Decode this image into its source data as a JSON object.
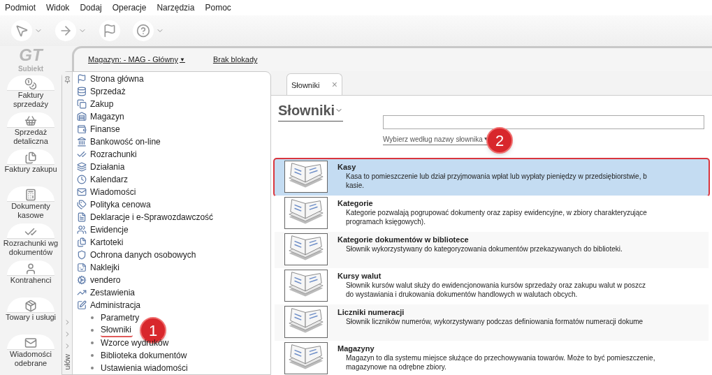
{
  "menu": [
    "Podmiot",
    "Widok",
    "Dodaj",
    "Operacje",
    "Narzędzia",
    "Pomoc"
  ],
  "toolbar": [
    {
      "dropdown": true
    },
    {
      "dropdown": true
    },
    {
      "dropdown": false
    },
    {
      "dropdown": true
    }
  ],
  "logo": {
    "mark": "GT",
    "name": "Subiekt"
  },
  "rail": [
    "Faktury sprzedaży",
    "Sprzedaż detaliczna",
    "Faktury zakupu",
    "Dokumenty kasowe",
    "Rozrachunki wg dokumentów",
    "Kontrahenci",
    "Towary i usługi",
    "Wiadomości odebrane"
  ],
  "header": {
    "warehouse": "Magazyn: - MAG - Główny",
    "warehouse_caret": "▼",
    "lock": "Brak blokady"
  },
  "side_strip": {
    "label": "ułów"
  },
  "nav": [
    {
      "label": "Strona główna"
    },
    {
      "label": "Sprzedaż"
    },
    {
      "label": "Zakup"
    },
    {
      "label": "Magazyn"
    },
    {
      "label": "Finanse"
    },
    {
      "label": "Bankowość on-line"
    },
    {
      "label": "Rozrachunki"
    },
    {
      "label": "Działania"
    },
    {
      "label": "Kalendarz"
    },
    {
      "label": "Wiadomości"
    },
    {
      "label": "Polityka cenowa"
    },
    {
      "label": "Deklaracje i e-Sprawozdawczość"
    },
    {
      "label": "Ewidencje"
    },
    {
      "label": "Kartoteki"
    },
    {
      "label": "Ochrona danych osobowych"
    },
    {
      "label": "Naklejki"
    },
    {
      "label": "vendero"
    },
    {
      "label": "Zestawienia"
    },
    {
      "label": "Administracja",
      "children": [
        {
          "label": "Parametry"
        },
        {
          "label": "Słowniki",
          "callout": "1"
        },
        {
          "label": "Wzorce wydruków"
        },
        {
          "label": "Biblioteka dokumentów"
        },
        {
          "label": "Ustawienia wiadomości"
        }
      ]
    }
  ],
  "tab": {
    "label": "Słowniki",
    "close": "×"
  },
  "title": "Słowniki",
  "search": {
    "filter_link": "Wybierz według nazwy słownika",
    "filter_caret": "▼",
    "callout": "2"
  },
  "dictionaries": [
    {
      "name": "Kasy",
      "selected": true,
      "outlined": true,
      "lines": [
        "Kasa to pomieszczenie lub dział przyjmowania wpłat lub wypłaty pieniędzy w przedsiębiorstwie, b",
        "kasie."
      ]
    },
    {
      "name": "Kategorie",
      "selected": false,
      "outlined": false,
      "lines": [
        "Kategorie pozwalają pogrupować dokumenty oraz zapisy ewidencyjne, w zbiory charakteryzujące",
        "programach księgowych)."
      ]
    },
    {
      "name": "Kategorie dokumentów w bibliotece",
      "selected": false,
      "outlined": false,
      "lines": [
        "Słownik wykorzystywany do kategoryzowania dokumentów przekazywanych do biblioteki."
      ]
    },
    {
      "name": "Kursy walut",
      "selected": false,
      "outlined": false,
      "lines": [
        "Słownik kursów walut służy do ewidencjonowania kursów sprzedaży oraz zakupu walut w poszcz",
        "do wystawiania i drukowania dokumentów handlowych w walutach obcych."
      ]
    },
    {
      "name": "Liczniki numeracji",
      "selected": false,
      "outlined": false,
      "lines": [
        "Słownik liczników numerów, wykorzystywany podczas definiowania formatów numeracji dokume"
      ]
    },
    {
      "name": "Magazyny",
      "selected": false,
      "outlined": false,
      "lines": [
        "Magazyn to dla systemu miejsce służące do przechowywania towarów. Może to być pomieszczenie,",
        "magazynowe na odrębne zbiory."
      ]
    }
  ]
}
